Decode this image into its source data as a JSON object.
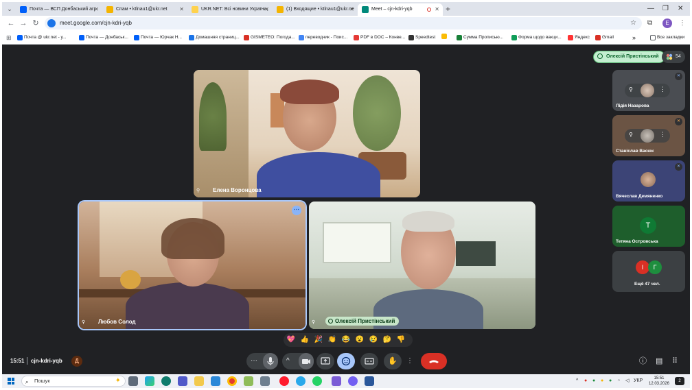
{
  "browser": {
    "tabs": [
      {
        "title": "Почта — ВСП Донбаський агр",
        "color": "#005ff9"
      },
      {
        "title": "Спам • ktlnau1@ukr.net",
        "color": "#f4b400"
      },
      {
        "title": "UKR.NET: Всі новини України,",
        "color": "#ffd24d"
      },
      {
        "title": "(1) Входящие • ktlnau1@ukr.ne",
        "color": "#f4b400"
      },
      {
        "title": "Meet – cjn-kdri-yqb",
        "color": "#00897b"
      }
    ],
    "new_tab": "+",
    "url": "meet.google.com/cjn-kdri-yqb",
    "profile_letter": "E",
    "bookmarks": [
      {
        "label": "Почта @ ukr.net - у...",
        "color": "#005ff9"
      },
      {
        "label": "Почта — Донбаськ...",
        "color": "#005ff9"
      },
      {
        "label": "Почта — Юрчак Н...",
        "color": "#005ff9"
      },
      {
        "label": "Домашняя страниц...",
        "color": "#1a73e8"
      },
      {
        "label": "GISMETEO: Погода...",
        "color": "#d93025"
      },
      {
        "label": "переводчик - Поис...",
        "color": "#4285f4"
      },
      {
        "label": "PDF в DOC – Конве...",
        "color": "#e53935"
      },
      {
        "label": "Speedtest",
        "color": "#333333"
      },
      {
        "label": "Сумма Прописью...",
        "color": "#188038"
      },
      {
        "label": "Форма щодо вакци...",
        "color": "#0f9d58"
      },
      {
        "label": "Яндекс",
        "color": "#ff3333"
      },
      {
        "label": "Gmail",
        "color": "#d93025"
      }
    ],
    "bookmarks_more": "»",
    "all_bookmarks": "Все закладки"
  },
  "meet": {
    "presenter": "Олексій Пристінський",
    "participant_count": "54",
    "main_tiles": [
      {
        "name": "Елена Воронцова"
      },
      {
        "name": "Любов Солод"
      },
      {
        "name": "Олексій Пристінський"
      }
    ],
    "side_tiles": [
      {
        "name": "Лідія Назарова"
      },
      {
        "name": "Станіслав Васюк"
      },
      {
        "name": "Вячеслав Демяненко"
      },
      {
        "name": "Тетяна Островська",
        "letter": "T"
      }
    ],
    "more_tile": {
      "letters": [
        "І",
        "Г"
      ],
      "label": "Ещё 47 чел."
    },
    "reactions": [
      "💖",
      "👍",
      "🎉",
      "👏",
      "😂",
      "😮",
      "😢",
      "🤔",
      "👎"
    ],
    "time": "15:51",
    "code": "cjn-kdri-yqb",
    "code_badge": "Д"
  },
  "taskbar": {
    "search": "Пошук",
    "lang": "УКР",
    "time": "15:51",
    "date": "12.03.2026",
    "notifications": "2"
  }
}
